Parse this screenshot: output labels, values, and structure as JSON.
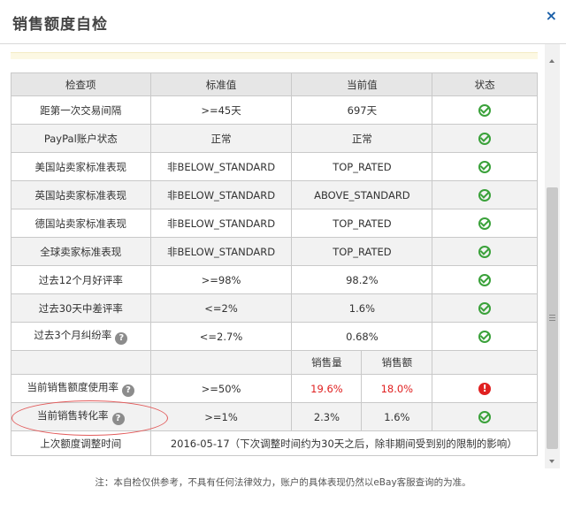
{
  "dialog": {
    "title": "销售额度自检",
    "close_label": "×"
  },
  "table": {
    "headers": [
      "检查项",
      "标准值",
      "当前值",
      "状态"
    ],
    "rows": [
      {
        "item": "距第一次交易间隔",
        "standard": ">=45天",
        "current": "697天",
        "status": "ok"
      },
      {
        "item": "PayPal账户状态",
        "standard": "正常",
        "current": "正常",
        "status": "ok"
      },
      {
        "item": "美国站卖家标准表现",
        "standard": "非BELOW_STANDARD",
        "current": "TOP_RATED",
        "status": "ok"
      },
      {
        "item": "英国站卖家标准表现",
        "standard": "非BELOW_STANDARD",
        "current": "ABOVE_STANDARD",
        "status": "ok"
      },
      {
        "item": "德国站卖家标准表现",
        "standard": "非BELOW_STANDARD",
        "current": "TOP_RATED",
        "status": "ok"
      },
      {
        "item": "全球卖家标准表现",
        "standard": "非BELOW_STANDARD",
        "current": "TOP_RATED",
        "status": "ok"
      },
      {
        "item": "过去12个月好评率",
        "standard": ">=98%",
        "current": "98.2%",
        "status": "ok"
      },
      {
        "item": "过去30天中差评率",
        "standard": "<=2%",
        "current": "1.6%",
        "status": "ok"
      },
      {
        "item": "过去3个月纠纷率",
        "standard": "<=2.7%",
        "current": "0.68%",
        "status": "ok",
        "help": "?"
      }
    ],
    "sub_headers": {
      "qty": "销售量",
      "amount": "销售额"
    },
    "quota_row": {
      "item": "当前销售额度使用率",
      "help": "?",
      "standard": ">=50%",
      "qty": "19.6%",
      "amount": "18.0%",
      "status": "error"
    },
    "conversion_row": {
      "item": "当前销售转化率",
      "help": "?",
      "standard": ">=1%",
      "qty": "2.3%",
      "amount": "1.6%",
      "status": "ok"
    },
    "last_adjust": {
      "item": "上次额度调整时间",
      "value": "2016-05-17（下次调整时间约为30天之后，除非期间受到别的限制的影响）"
    }
  },
  "footer": {
    "note": "注：本自检仅供参考，不具有任何法律效力，账户的具体表现仍然以eBay客服查询的为准。"
  },
  "colors": {
    "ok": "#3aa13a",
    "error": "#e02020",
    "link": "#1a5fa8",
    "annotation": "#e25b5b"
  }
}
